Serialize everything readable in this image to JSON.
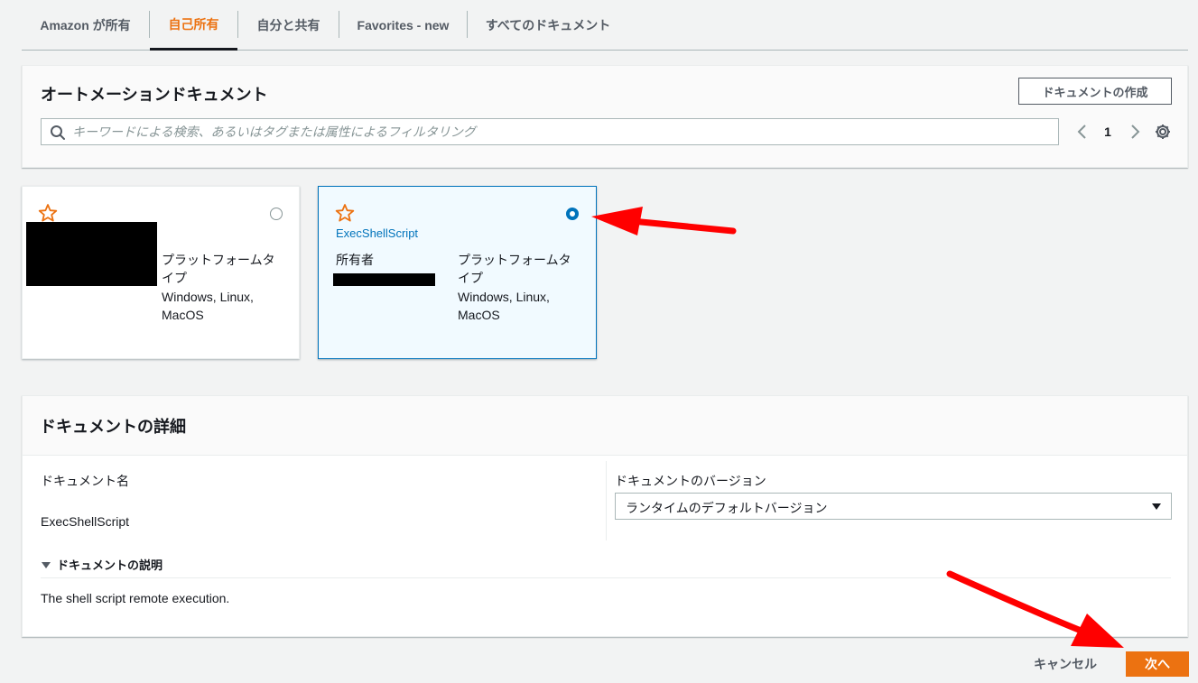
{
  "tabs": [
    {
      "label": "Amazon が所有",
      "active": false
    },
    {
      "label": "自己所有",
      "active": true
    },
    {
      "label": "自分と共有",
      "active": false
    },
    {
      "label": "Favorites - new",
      "active": false
    },
    {
      "label": "すべてのドキュメント",
      "active": false
    }
  ],
  "automation": {
    "title": "オートメーションドキュメント",
    "create_button": "ドキュメントの作成",
    "search_placeholder": "キーワードによる検索、あるいはタグまたは属性によるフィルタリング",
    "search_value": "",
    "page_number": "1"
  },
  "cards": [
    {
      "name": "",
      "selected": false,
      "platform_label": "プラットフォームタイプ",
      "platform_value": "Windows, Linux, MacOS"
    },
    {
      "name": "ExecShellScript",
      "selected": true,
      "owner_label": "所有者",
      "platform_label": "プラットフォームタイプ",
      "platform_value": "Windows, Linux, MacOS"
    }
  ],
  "details": {
    "title": "ドキュメントの詳細",
    "name_label": "ドキュメント名",
    "name_value": "ExecShellScript",
    "version_label": "ドキュメントのバージョン",
    "version_value": "ランタイムのデフォルトバージョン",
    "description_toggle": "ドキュメントの説明",
    "description_value": "The shell script remote execution."
  },
  "footer": {
    "cancel_label": "キャンセル",
    "next_label": "次へ"
  },
  "colors": {
    "accent": "#ec7211",
    "link": "#0073bb",
    "annotation_arrow": "#ff0000"
  }
}
